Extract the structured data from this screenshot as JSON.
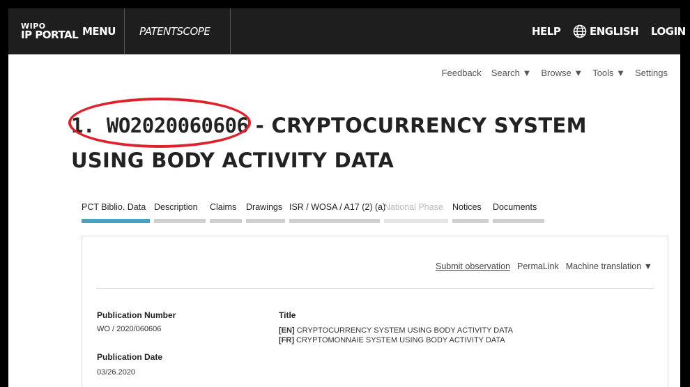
{
  "topbar": {
    "logo_line1": "WIPO",
    "logo_line2": "IP PORTAL",
    "menu": "MENU",
    "product": "PATENTSCOPE",
    "help": "HELP",
    "language": "ENGLISH",
    "login": "LOGIN",
    "globe_icon": "globe-icon"
  },
  "subnav": {
    "feedback": "Feedback",
    "search": "Search ▼",
    "browse": "Browse ▼",
    "tools": "Tools ▼",
    "settings": "Settings"
  },
  "document": {
    "id_prefix": "1. WO2020060606",
    "title_rest": " - CRYPTOCURRENCY SYSTEM USING BODY ACTIVITY DATA"
  },
  "tabs": [
    {
      "label": "PCT Biblio. Data",
      "state": "active"
    },
    {
      "label": "Description",
      "state": "normal"
    },
    {
      "label": "Claims",
      "state": "normal"
    },
    {
      "label": "Drawings",
      "state": "normal"
    },
    {
      "label": "ISR / WOSA / A17 (2) (a)",
      "state": "normal"
    },
    {
      "label": "National Phase",
      "state": "disabled"
    },
    {
      "label": "Notices",
      "state": "normal"
    },
    {
      "label": "Documents",
      "state": "normal"
    }
  ],
  "actions": {
    "submit": "Submit observation",
    "permalink": "PermaLink",
    "machine_translation": "Machine translation ▼"
  },
  "biblio": {
    "pub_number_label": "Publication Number",
    "pub_number": "WO / 2020/060606",
    "pub_date_label": "Publication Date",
    "pub_date": "03/26.2020",
    "title_label": "Title",
    "title_en_lang": "[EN]",
    "title_en": " CRYPTOCURRENCY SYSTEM USING BODY ACTIVITY DATA",
    "title_fr_lang": "[FR]",
    "title_fr": " CRYPTOMONNAIE SYSTEM USING BODY ACTIVITY DATA"
  },
  "colors": {
    "topbar_bg": "#1e1e1e",
    "active_tab": "#4aa0c0",
    "annotation_circle": "#e0202a"
  }
}
